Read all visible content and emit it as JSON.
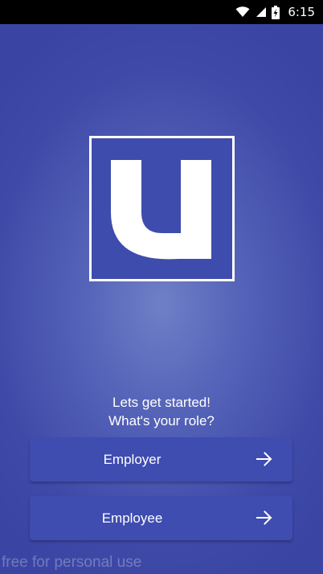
{
  "status_bar": {
    "time": "6:15",
    "icons": [
      "wifi-icon",
      "signal-icon",
      "battery-charging-icon"
    ]
  },
  "logo": {
    "letter": "u",
    "background": "#3e4cad",
    "border_color": "#ffffff"
  },
  "prompt": {
    "line1": "Lets get started!",
    "line2": "What's your role?"
  },
  "roles": {
    "employer_label": "Employer",
    "employee_label": "Employee",
    "arrow_icon": "arrow-right-icon"
  },
  "watermark": "free for personal use",
  "colors": {
    "background": "#4a58b5",
    "button": "#3f4cb0",
    "text": "#ffffff"
  }
}
